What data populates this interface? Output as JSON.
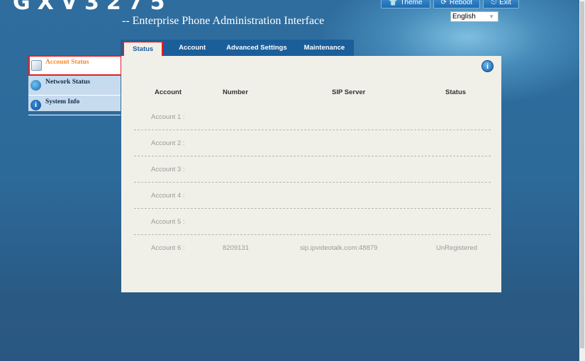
{
  "header": {
    "brand": "GXV3275",
    "subtitle": "-- Enterprise Phone Administration Interface",
    "buttons": [
      {
        "label": "Theme",
        "icon": "theme-icon"
      },
      {
        "label": "Reboot",
        "icon": "reboot-icon"
      },
      {
        "label": "Exit",
        "icon": "exit-icon"
      }
    ],
    "language": "English"
  },
  "tabs": [
    {
      "label": "Status",
      "active": true
    },
    {
      "label": "Account"
    },
    {
      "label": "Advanced Settings"
    },
    {
      "label": "Maintenance"
    }
  ],
  "sidebar": {
    "items": [
      {
        "label": "Account Status",
        "active": true
      },
      {
        "label": "Network Status"
      },
      {
        "label": "System Info"
      }
    ]
  },
  "table": {
    "columns": [
      "Account",
      "Number",
      "SIP Server",
      "Status"
    ],
    "rows": [
      {
        "account": "Account 1 :",
        "number": "",
        "sip": "",
        "status": ""
      },
      {
        "account": "Account 2 :",
        "number": "",
        "sip": "",
        "status": ""
      },
      {
        "account": "Account 3 :",
        "number": "",
        "sip": "",
        "status": ""
      },
      {
        "account": "Account 4 :",
        "number": "",
        "sip": "",
        "status": ""
      },
      {
        "account": "Account 5 :",
        "number": "",
        "sip": "",
        "status": ""
      },
      {
        "account": "Account 6 :",
        "number": "8209131",
        "sip": "sip.ipvideotalk.com:48879",
        "status": "UnRegistered"
      }
    ]
  },
  "colors": {
    "accent_orange": "#f08a2a",
    "highlight_red": "#e02020",
    "tab_blue": "#1a5f9a"
  }
}
